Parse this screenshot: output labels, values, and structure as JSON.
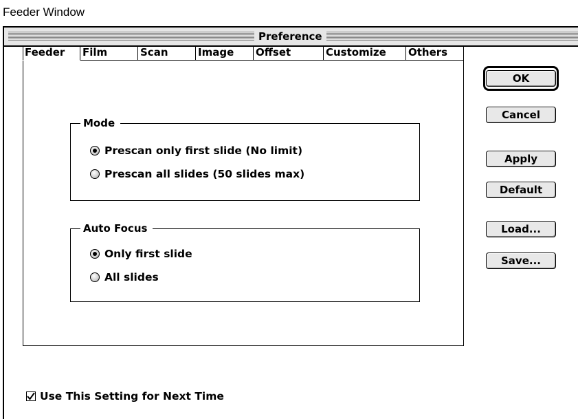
{
  "caption": "Feeder Window",
  "window": {
    "title": "Preference"
  },
  "tabs": [
    {
      "label": "Feeder",
      "active": true
    },
    {
      "label": "Film",
      "active": false
    },
    {
      "label": "Scan",
      "active": false
    },
    {
      "label": "Image",
      "active": false
    },
    {
      "label": "Offset",
      "active": false
    },
    {
      "label": "Customize",
      "active": false
    },
    {
      "label": "Others",
      "active": false
    }
  ],
  "mode": {
    "label": "Mode",
    "options": [
      {
        "label": "Prescan only first slide (No limit)",
        "checked": true
      },
      {
        "label": "Prescan all slides (50 slides max)",
        "checked": false
      }
    ]
  },
  "auto_focus": {
    "label": "Auto Focus",
    "options": [
      {
        "label": "Only first slide",
        "checked": true
      },
      {
        "label": "All slides",
        "checked": false
      }
    ]
  },
  "buttons": {
    "ok": "OK",
    "cancel": "Cancel",
    "apply": "Apply",
    "default": "Default",
    "load": "Load...",
    "save": "Save..."
  },
  "use_setting": {
    "label": "Use This Setting for Next Time",
    "checked": true
  }
}
